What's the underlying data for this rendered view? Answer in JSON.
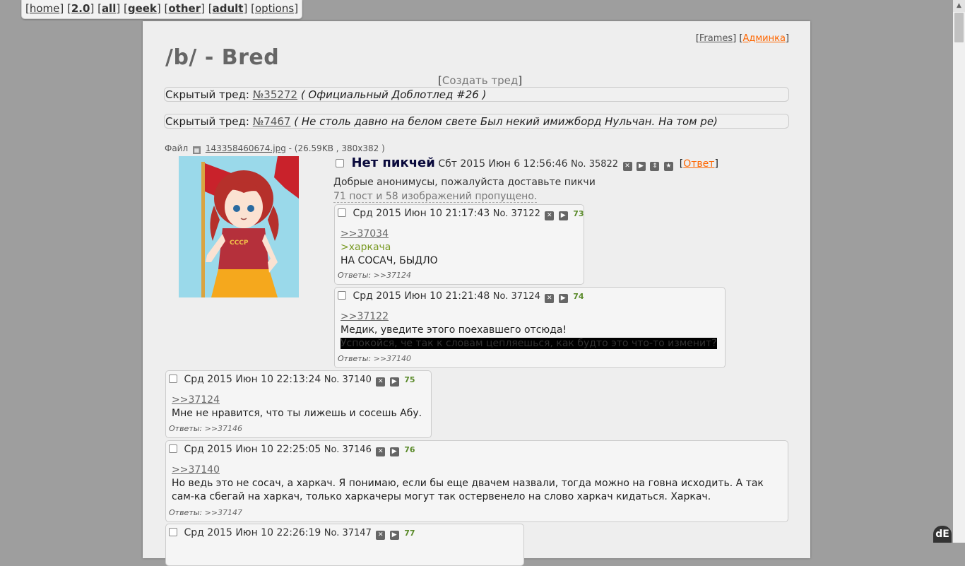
{
  "topnav": {
    "home": "home",
    "v2": "2.0",
    "all": "all",
    "geek": "geek",
    "other": "other",
    "adult": "adult",
    "options": "options"
  },
  "toplinks": {
    "frames": "Frames",
    "admin": "Админка"
  },
  "board": {
    "title": "/b/ - Bred",
    "create_thread": "Создать тред"
  },
  "hidden_threads": [
    {
      "label": "Скрытый тред:",
      "num": "№35272",
      "subject": "( Официальный Доблотлед #26 )"
    },
    {
      "label": "Скрытый тред:",
      "num": "№7467",
      "subject": "( Не столь давно на белом свете Был некий имижборд Нульчан. На том ре)"
    }
  ],
  "op": {
    "file_label": "Файл",
    "file_name": "143358460674.jpg",
    "file_meta": "- (26.59KB , 380x382 )",
    "image_alt": "anime girl with red flag",
    "subject": "Нет пикчей",
    "date": "Сбт 2015 Июн 6 12:56:46",
    "no": "No. 35822",
    "reply": "Ответ",
    "message": "Добрые анонимусы, пожалуйста доставьте пикчи",
    "omitted": "71 пост и 58 изображений пропущено."
  },
  "posts": [
    {
      "date": "Срд 2015 Июн 10 21:17:43",
      "no": "No. 37122",
      "counter": "73",
      "quote": ">>37034",
      "green": ">харкача",
      "text": "НА СОСАЧ, БЫДЛО",
      "replies_label": "Ответы:",
      "replies": ">>37124"
    },
    {
      "date": "Срд 2015 Июн 10 21:21:48",
      "no": "No. 37124",
      "counter": "74",
      "quote": ">>37122",
      "text": "Медик, уведите этого поехавшего отсюда!",
      "spoiler": "Успокойся, че так к словам цепляешься, как будто это что-то изменит?",
      "replies_label": "Ответы:",
      "replies": ">>37140"
    },
    {
      "date": "Срд 2015 Июн 10 22:13:24",
      "no": "No. 37140",
      "counter": "75",
      "quote": ">>37124",
      "text": "Мне не нравится, что ты лижешь и сосешь Абу.",
      "replies_label": "Ответы:",
      "replies": ">>37146"
    },
    {
      "date": "Срд 2015 Июн 10 22:25:05",
      "no": "No. 37146",
      "counter": "76",
      "quote": ">>37140",
      "text1": "Но ведь это не сосач, а харкач. Я понимаю, если бы еще двачем назвали, тогда можно на говна исходить. А так",
      "text2": "сам-ка сбегай на харкач, только харкачеры могут так остервенело на слово харкач кидаться. Харкач.",
      "replies_label": "Ответы:",
      "replies": ">>37147"
    },
    {
      "date": "Срд 2015 Июн 10 22:26:19",
      "no": "No. 37147",
      "counter": "77"
    }
  ],
  "icons": {
    "hide": "hide-icon",
    "report": "report-icon",
    "expand": "expand-icon",
    "star": "star-icon"
  },
  "colors": {
    "accent_orange": "#ff6600",
    "green_num": "#5a8a2a",
    "greentext": "#789922"
  }
}
